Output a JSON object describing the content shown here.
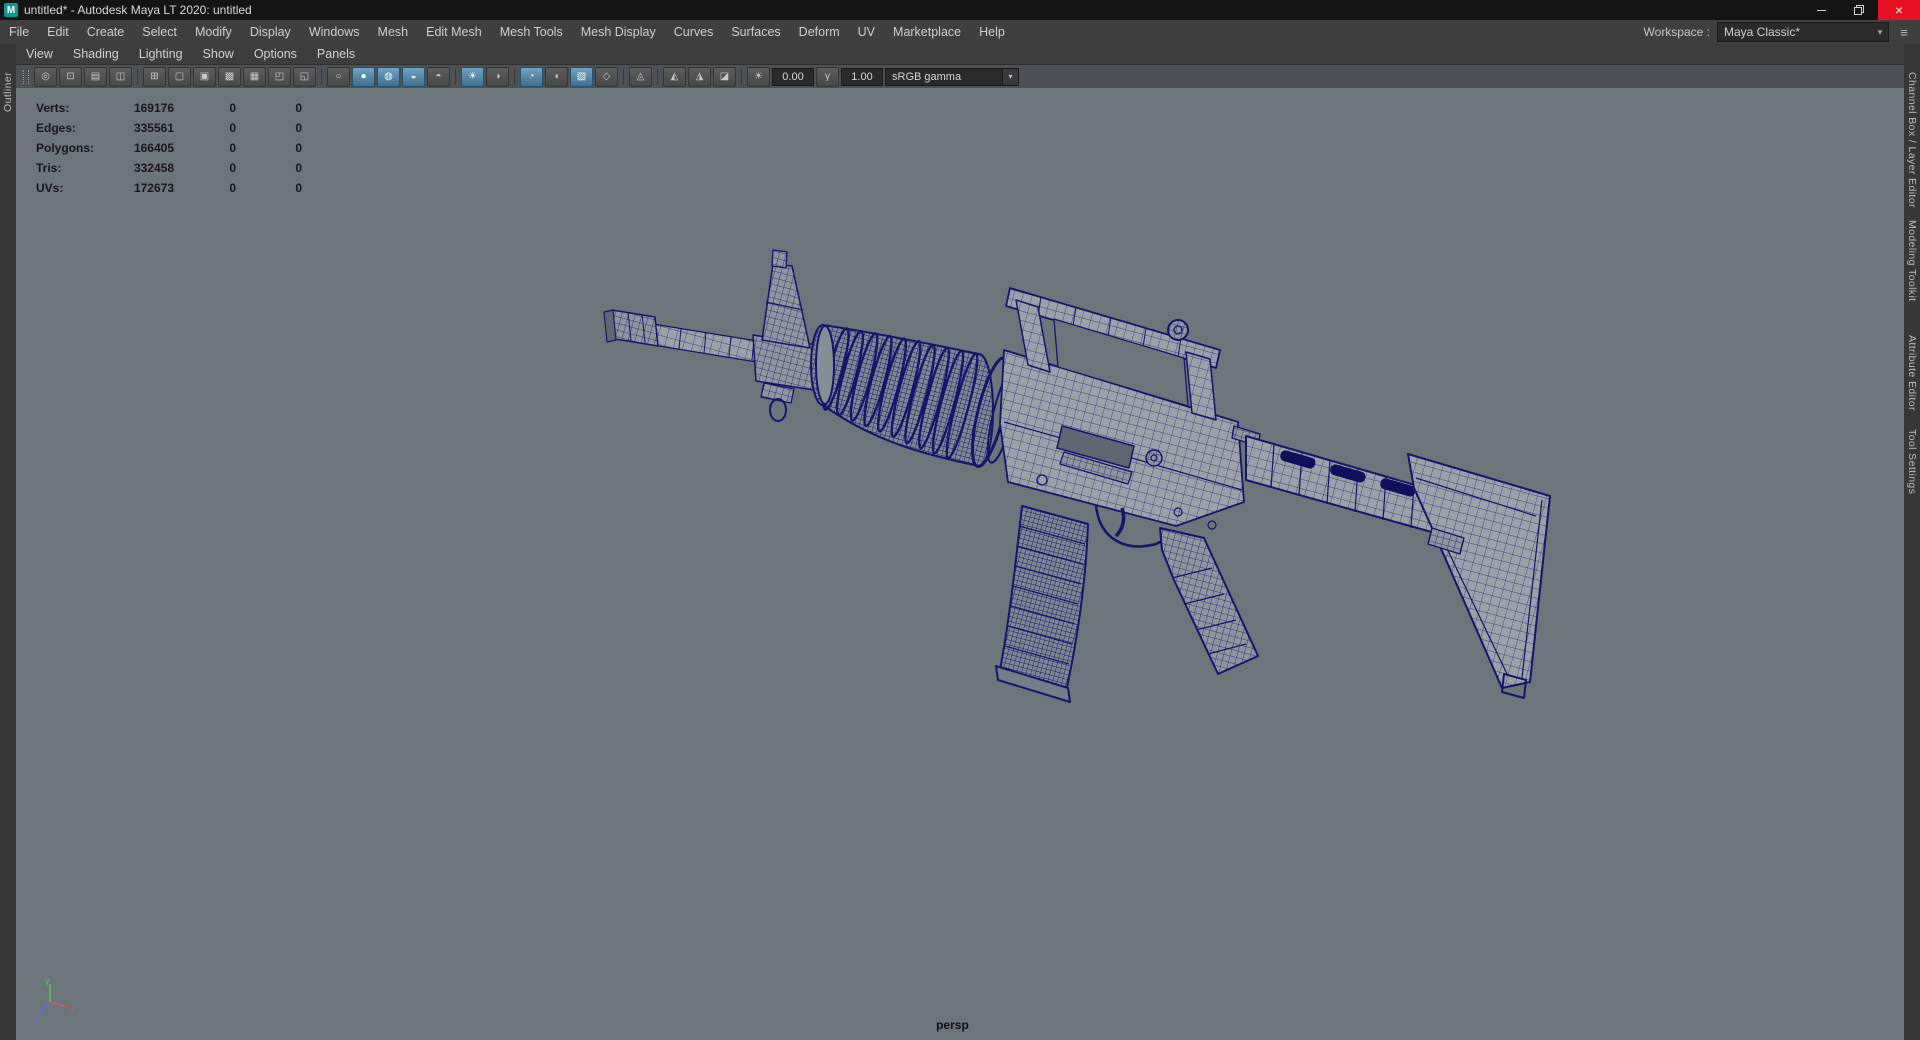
{
  "window": {
    "logo": "M",
    "title": "untitled* - Autodesk Maya LT 2020: untitled",
    "close_glyph": "×"
  },
  "menus": [
    "File",
    "Edit",
    "Create",
    "Select",
    "Modify",
    "Display",
    "Windows",
    "Mesh",
    "Edit Mesh",
    "Mesh Tools",
    "Mesh Display",
    "Curves",
    "Surfaces",
    "Deform",
    "UV",
    "Marketplace",
    "Help"
  ],
  "workspace": {
    "label": "Workspace :",
    "value": "Maya Classic*",
    "arrow": "▾",
    "options_glyph": "≡"
  },
  "panel_menus": [
    "View",
    "Shading",
    "Lighting",
    "Show",
    "Options",
    "Panels"
  ],
  "toolbar": {
    "icons": [
      {
        "name": "select-camera-icon",
        "glyph": "◎",
        "active": false
      },
      {
        "name": "camera-attributes-icon",
        "glyph": "⊡",
        "active": false
      },
      {
        "name": "bookmarks-icon",
        "glyph": "▤",
        "active": false
      },
      {
        "name": "image-plane-icon",
        "glyph": "◫",
        "active": false
      },
      {
        "name": "grid-icon",
        "glyph": "⊞",
        "active": false
      },
      {
        "name": "film-gate-icon",
        "glyph": "▢",
        "active": false
      },
      {
        "name": "resolution-gate-icon",
        "glyph": "▣",
        "active": false
      },
      {
        "name": "gate-mask-icon",
        "glyph": "▩",
        "active": false
      },
      {
        "name": "field-chart-icon",
        "glyph": "▦",
        "active": false
      },
      {
        "name": "safe-action-icon",
        "glyph": "◰",
        "active": false
      },
      {
        "name": "safe-title-icon",
        "glyph": "◱",
        "active": false
      },
      {
        "name": "wireframe-icon",
        "glyph": "○",
        "active": false
      },
      {
        "name": "smooth-shade-icon",
        "glyph": "●",
        "active": true
      },
      {
        "name": "wireframe-on-shaded-icon",
        "glyph": "◍",
        "active": true
      },
      {
        "name": "textured-icon",
        "glyph": "◒",
        "active": true
      },
      {
        "name": "use-default-material-icon",
        "glyph": "◓",
        "active": false
      },
      {
        "name": "all-lights-icon",
        "glyph": "☀",
        "active": true
      },
      {
        "name": "shadows-icon",
        "glyph": "◑",
        "active": false
      },
      {
        "name": "ssao-icon",
        "glyph": "◔",
        "active": true
      },
      {
        "name": "motion-blur-icon",
        "glyph": "◖",
        "active": false
      },
      {
        "name": "multisample-aa-icon",
        "glyph": "▧",
        "active": true
      },
      {
        "name": "depth-of-field-icon",
        "glyph": "◇",
        "active": false
      },
      {
        "name": "isolate-select-icon",
        "glyph": "◬",
        "active": false
      },
      {
        "name": "xray-icon",
        "glyph": "◭",
        "active": false
      },
      {
        "name": "xray-joints-icon",
        "glyph": "◮",
        "active": false
      },
      {
        "name": "plane-select-icon",
        "glyph": "◪",
        "active": false
      }
    ],
    "exposure": {
      "glyph": "☀",
      "value": "0.00"
    },
    "gamma": {
      "glyph": "γ",
      "value": "1.00"
    },
    "view_transform": {
      "value": "sRGB gamma",
      "arrow": "▾"
    }
  },
  "hud": {
    "rows": [
      {
        "label": "Verts:",
        "value": "169176",
        "col2": "0",
        "col3": "0"
      },
      {
        "label": "Edges:",
        "value": "335561",
        "col2": "0",
        "col3": "0"
      },
      {
        "label": "Polygons:",
        "value": "166405",
        "col2": "0",
        "col3": "0"
      },
      {
        "label": "Tris:",
        "value": "332458",
        "col2": "0",
        "col3": "0"
      },
      {
        "label": "UVs:",
        "value": "172673",
        "col2": "0",
        "col3": "0"
      }
    ]
  },
  "side_tabs": {
    "left": [
      "Outliner"
    ],
    "right": [
      "Channel Box / Layer Editor",
      "Modeling Toolkit",
      "Attribute Editor",
      "Tool Settings"
    ]
  },
  "viewport": {
    "camera": "persp",
    "axis_labels": {
      "x": "x",
      "y": "y",
      "z": "z"
    }
  },
  "colors": {
    "viewport_bg": "#6c757a",
    "wireframe": "#15156b",
    "active_button": "#3f6f8c",
    "close_button": "#e81123",
    "maya_logo": "#0f9a8f"
  }
}
